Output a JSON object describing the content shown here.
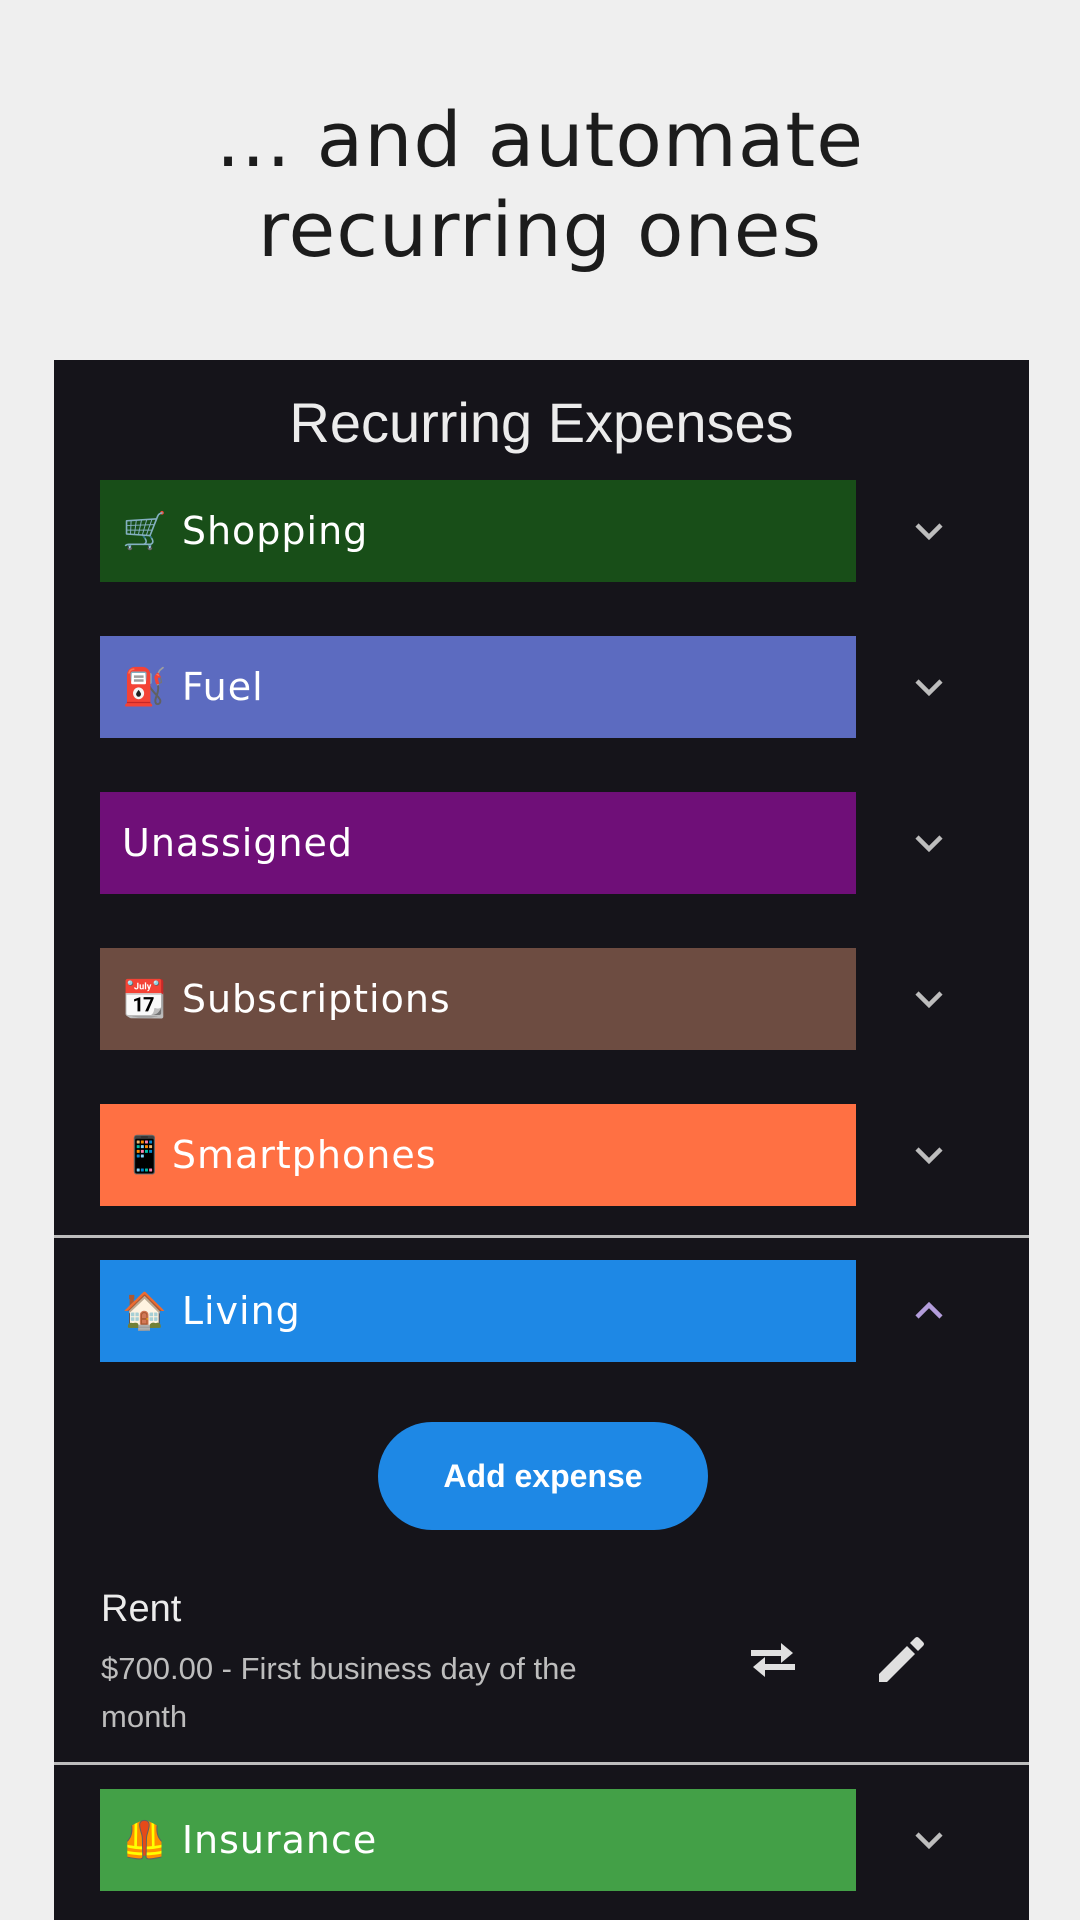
{
  "headline": {
    "line1": "... and automate",
    "line2": "recurring ones"
  },
  "screen": {
    "title": "Recurring Expenses",
    "categories": [
      {
        "emoji": "🛒",
        "label": "Shopping",
        "color": "#184e18",
        "expanded": false
      },
      {
        "emoji": "⛽",
        "label": "Fuel",
        "color": "#5c6bc0",
        "expanded": false
      },
      {
        "emoji": "",
        "label": "Unassigned",
        "color": "#6f0f78",
        "expanded": false
      },
      {
        "emoji": "📆",
        "label": "Subscriptions",
        "color": "#6d4c41",
        "expanded": false
      },
      {
        "emoji": "📱",
        "label": "Smartphones",
        "color": "#ff7043",
        "expanded": false
      },
      {
        "emoji": "🏠",
        "label": "Living",
        "color": "#1e88e5",
        "expanded": true
      },
      {
        "emoji": "🦺",
        "label": "Insurance",
        "color": "#43a047",
        "expanded": false
      }
    ],
    "living": {
      "add_button": "Add expense",
      "item": {
        "title": "Rent",
        "subtitle": "$700.00 - First business day of the month",
        "transfer_icon": "swap-arrows-icon",
        "edit_icon": "pencil-icon"
      }
    }
  },
  "colors": {
    "background": "#efefef",
    "screen_background": "#15141a",
    "chevron": "#bdbdbd",
    "chevron_active": "#b39ddb",
    "accent": "#1e88e5"
  }
}
